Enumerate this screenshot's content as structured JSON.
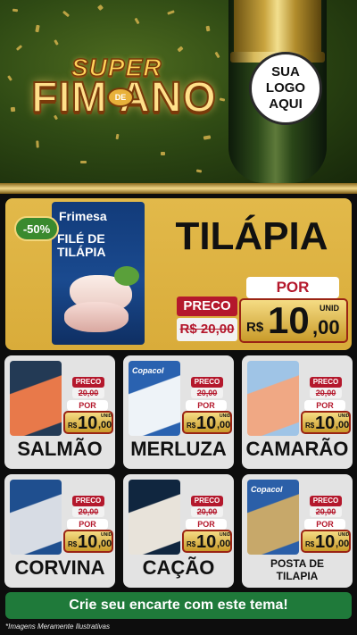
{
  "header": {
    "title_top": "SUPER",
    "title_main": "FIM ANO",
    "title_connector": "DE",
    "logo_placeholder": "SUA\nLOGO\nAQUI"
  },
  "hero": {
    "badge": "-50%",
    "product_title": "TILÁPIA",
    "package": {
      "brand": "Frimesa",
      "name": "FILÉ DE\nTILÁPIA"
    },
    "price": {
      "preco_label": "PRECO",
      "old_price": "R$ 20,00",
      "por_label": "POR",
      "unit_label": "UNID",
      "currency": "R$",
      "integer": "10",
      "cents": ",00"
    }
  },
  "price_template": {
    "preco_label": "PRECO",
    "old_price": "20,00",
    "por_label": "POR",
    "unit_label": "UNID",
    "currency": "R$",
    "integer": "10",
    "cents": ",00"
  },
  "products": [
    {
      "name": "SALMÃO",
      "small": false,
      "img_color": "#e8794a",
      "img_bg": "#233a55"
    },
    {
      "name": "MERLUZA",
      "small": false,
      "img_color": "#eef3f8",
      "img_bg": "#2a62b0",
      "brand": "Copacol"
    },
    {
      "name": "CAMARÃO",
      "small": false,
      "img_color": "#f0a884",
      "img_bg": "#9fc4e6"
    },
    {
      "name": "CORVINA",
      "small": false,
      "img_color": "#d7dce4",
      "img_bg": "#1f4f8f"
    },
    {
      "name": "CAÇÃO",
      "small": false,
      "img_color": "#e8e3da",
      "img_bg": "#10263f"
    },
    {
      "name": "POSTA DE\nTILAPIA",
      "small": true,
      "img_color": "#c7a86a",
      "img_bg": "#2b5fa8",
      "brand": "Copacol"
    }
  ],
  "footer": {
    "cta": "Crie seu encarte com este tema!",
    "disclaimer": "*Imagens Meramente Ilustrativas"
  },
  "colors": {
    "price_red": "#b4182c",
    "gold": "#d9ac3a",
    "cta_green": "#1f7a3a",
    "card_bg": "#e3e3e3"
  }
}
